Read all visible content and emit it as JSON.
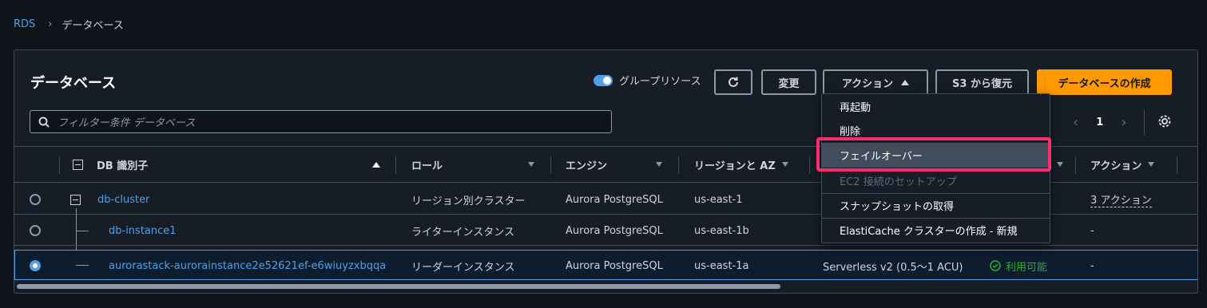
{
  "breadcrumb": {
    "root": "RDS",
    "separator": "›",
    "current": "データベース"
  },
  "panel": {
    "title": "データベース",
    "group_resources_label": "グループリソース",
    "refresh_label": "",
    "modify_label": "変更",
    "actions_label": "アクション",
    "restore_label": "S3 から復元",
    "create_label": "データベースの作成",
    "filter_placeholder": "フィルター条件 データベース",
    "page_number": "1"
  },
  "table": {
    "headers": {
      "identifier": "DB 識別子",
      "role": "ロール",
      "engine": "エンジン",
      "region": "リージョンと AZ",
      "actions": "アクション"
    },
    "rows": [
      {
        "identifier": "db-cluster",
        "role": "リージョン別クラスター",
        "engine": "Aurora PostgreSQL",
        "region": "us-east-1",
        "size": "",
        "status": "",
        "actions": "3 アクション"
      },
      {
        "identifier": "db-instance1",
        "role": "ライターインスタンス",
        "engine": "Aurora PostgreSQL",
        "region": "us-east-1b",
        "size": "",
        "status": "",
        "actions": "-"
      },
      {
        "identifier": "aurorastack-aurorainstance2e52621ef-e6wiuyzxbqqa",
        "role": "リーダーインスタンス",
        "engine": "Aurora PostgreSQL",
        "region": "us-east-1a",
        "size": "Serverless v2 (0.5〜1 ACU)",
        "status": "利用可能",
        "actions": "-"
      }
    ]
  },
  "menu": {
    "items": [
      {
        "label": "再起動",
        "enabled": true
      },
      {
        "label": "削除",
        "enabled": true
      },
      {
        "label": "フェイルオーバー",
        "enabled": true,
        "highlighted": true
      },
      {
        "label": "EC2 接続のセットアップ",
        "enabled": false
      },
      {
        "label": "スナップショットの取得",
        "enabled": true
      },
      {
        "label": "ElastiCache クラスターの作成 - 新規",
        "enabled": true
      }
    ]
  },
  "colors": {
    "accent": "#539fe5",
    "primary": "#ff9900",
    "success": "#29ad32",
    "highlight": "#ff2d6b"
  }
}
